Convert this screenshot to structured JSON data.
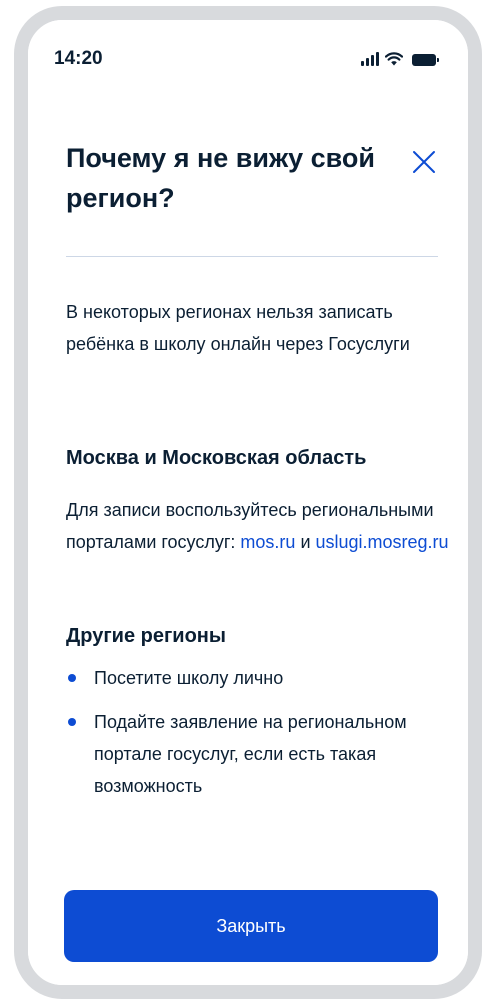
{
  "status_bar": {
    "time": "14:20"
  },
  "modal": {
    "title": "Почему я не вижу свой регион?",
    "intro": "В некоторых регионах нельзя записать ребёнка в школу онлайн через Госуслуги",
    "moscow_section": {
      "title": "Москва и Московская область",
      "text_before": "Для записи воспользуйтесь региональными порталами госуслуг: ",
      "link1": "mos.ru",
      "conjunction": " и ",
      "link2": "uslugi.mosreg.ru"
    },
    "other_section": {
      "title": "Другие регионы",
      "items": [
        "Посетите школу лично",
        "Подайте заявление на региональном портале госуслуг, если есть такая возможность"
      ]
    },
    "close_button_label": "Закрыть"
  },
  "colors": {
    "accent": "#0d4cd3",
    "text": "#0b1f33",
    "divider": "#cdd7e6",
    "device_frame": "#d8dadd"
  },
  "icons": {
    "close": "close-icon",
    "signal": "cellular-signal-icon",
    "wifi": "wifi-icon",
    "battery": "battery-icon"
  }
}
